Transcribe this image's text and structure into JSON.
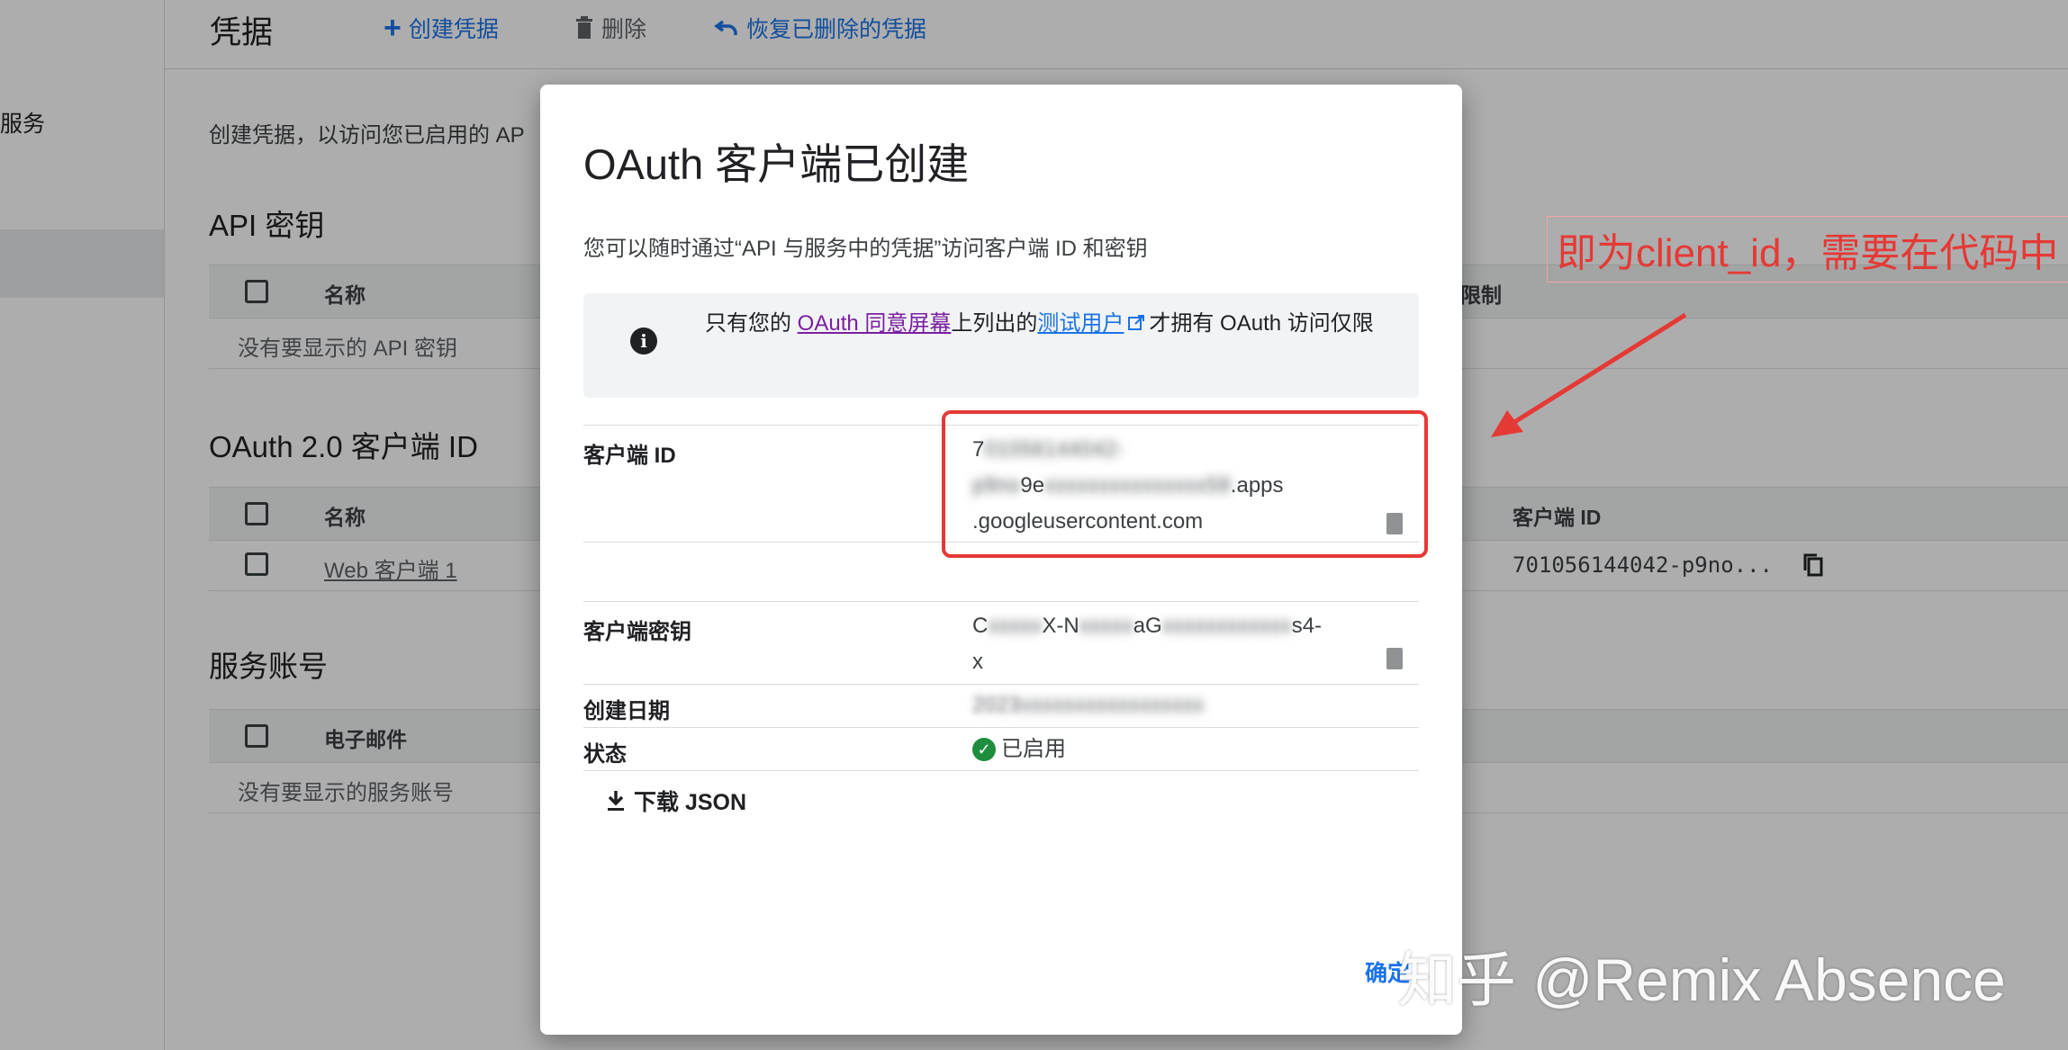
{
  "sidebar": {
    "item_label": "服务"
  },
  "topbar": {
    "title": "凭据",
    "create_label": "创建凭据",
    "delete_label": "删除",
    "restore_label": "恢复已删除的凭据"
  },
  "intro_text": "创建凭据，以访问您已启用的 AP",
  "api_keys": {
    "title": "API 密钥",
    "col_name": "名称",
    "col_restrict": "限制",
    "empty": "没有要显示的 API 密钥"
  },
  "oauth": {
    "title": "OAuth 2.0 客户端 ID",
    "col_name": "名称",
    "col_client_id": "客户端 ID",
    "row_name": "Web 客户端 1",
    "row_client_id": "701056144042-p9no..."
  },
  "service_accounts": {
    "title": "服务账号",
    "col_email": "电子邮件",
    "empty": "没有要显示的服务账号"
  },
  "dialog": {
    "title": "OAuth 客户端已创建",
    "subtitle": "您可以随时通过“API 与服务中的凭据”访问客户端 ID 和密钥",
    "notice_prefix": "只有您的 ",
    "notice_link1": "OAuth 同意屏幕",
    "notice_mid": "上列出的",
    "notice_link2": "测试用户",
    "notice_suffix": "才拥有 OAuth 访问仅限",
    "client_id_label": "客户端 ID",
    "client_id_line1": "7",
    "client_id_line2": "9e",
    "client_id_apps": ".apps",
    "client_id_domain": ".googleusercontent.com",
    "secret_label": "客户端密钥",
    "secret_line1_start": "C",
    "secret_line1_mid": "X-N",
    "secret_line1_mid2": "aG",
    "secret_line1_end": "s4-",
    "secret_line2": "x",
    "created_label": "创建日期",
    "created_value": "2023",
    "status_label": "状态",
    "status_value": "已启用",
    "download_label": "下载 JSON",
    "ok_label": "确定"
  },
  "annotation": {
    "text": "即为client_id，需要在代码中",
    "color": "#e53935"
  },
  "watermark": "知乎 @Remix Absence"
}
